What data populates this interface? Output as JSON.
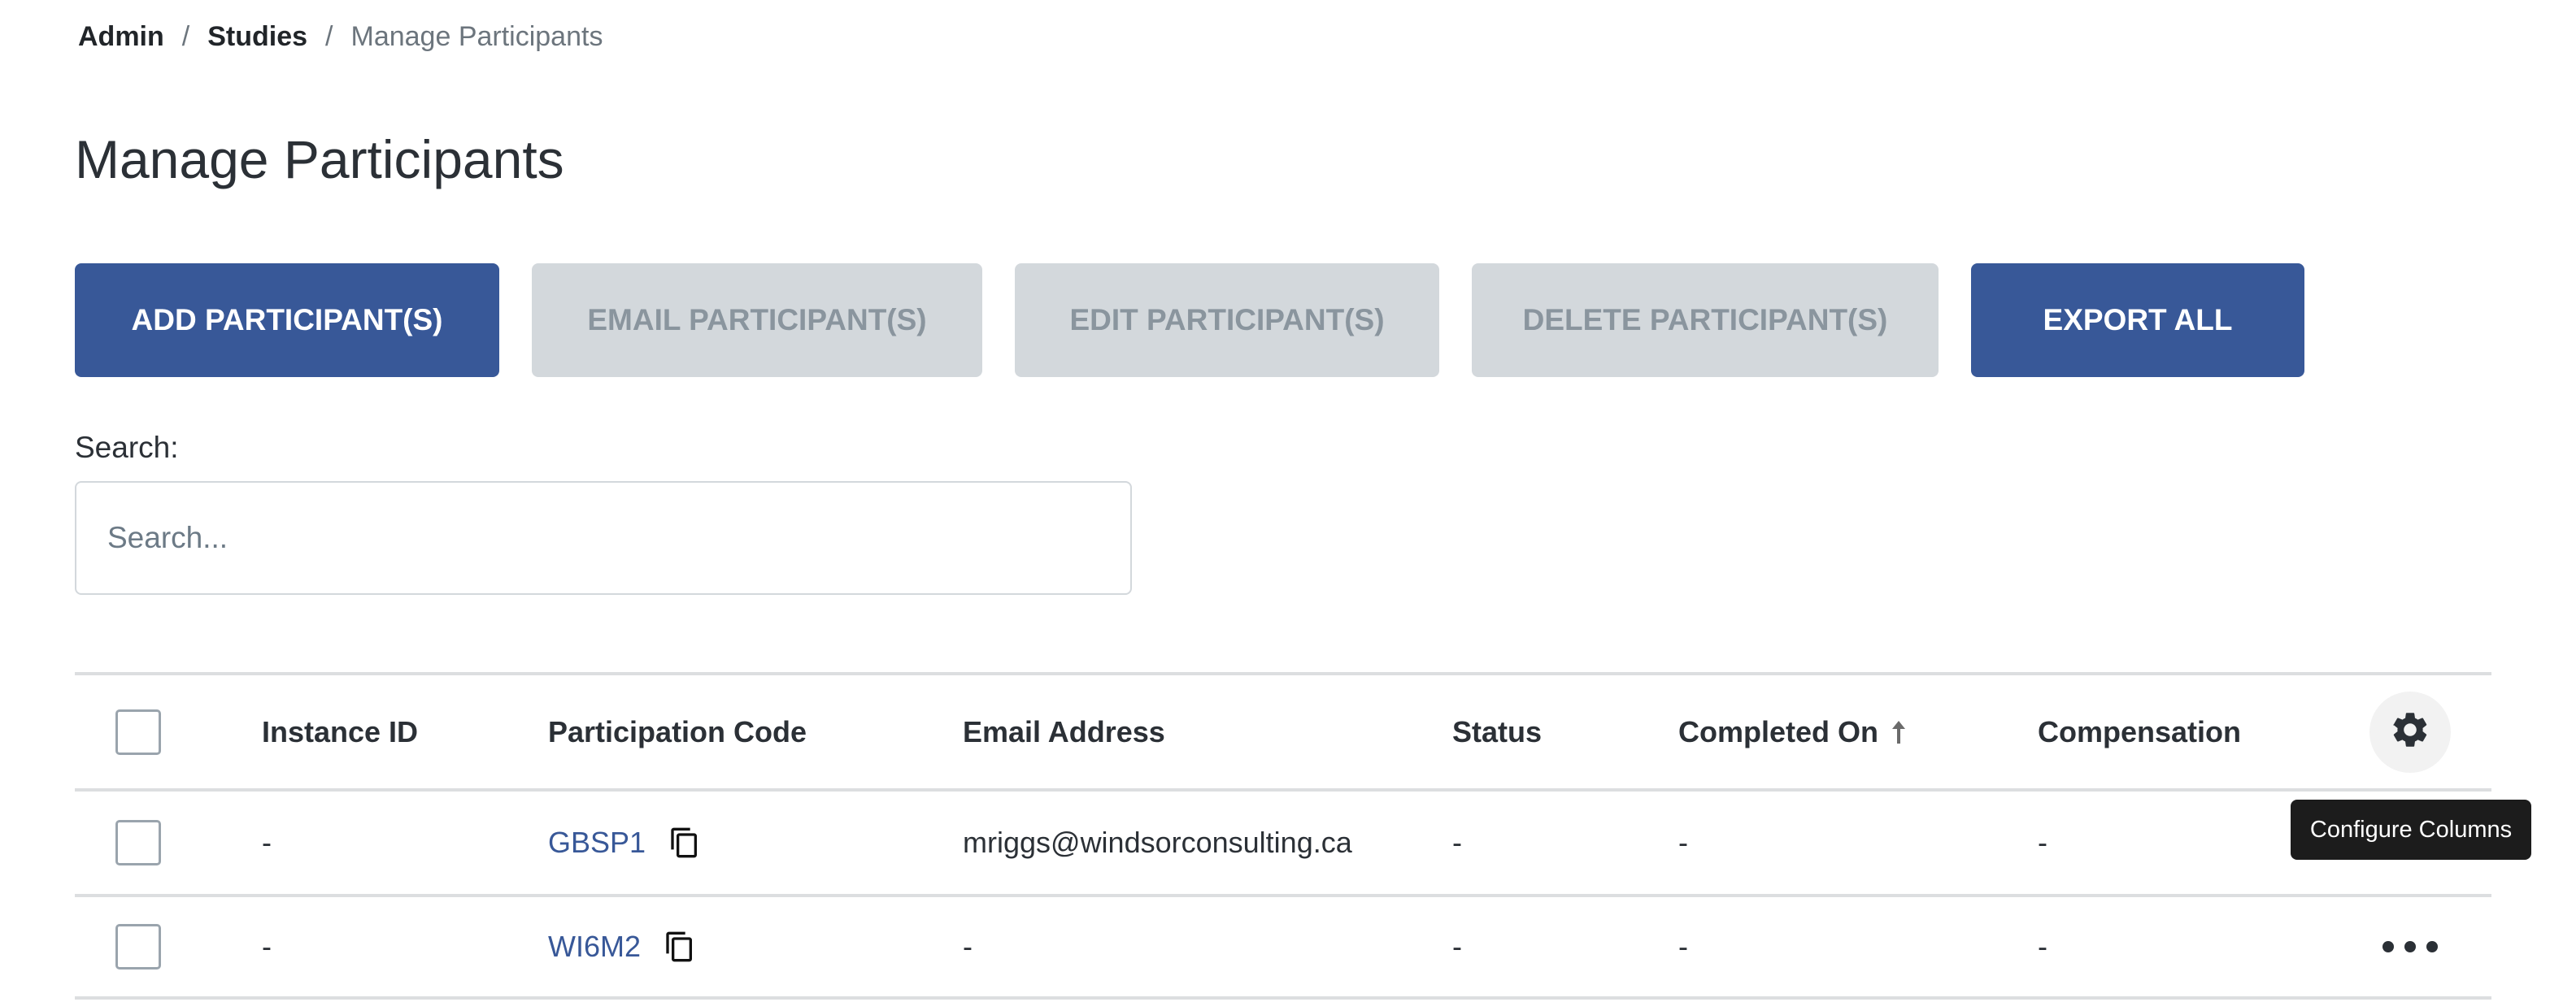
{
  "breadcrumb": {
    "items": [
      "Admin",
      "Studies"
    ],
    "separator": "/",
    "current": "Manage Participants"
  },
  "page": {
    "title": "Manage Participants"
  },
  "toolbar": {
    "add_label": "ADD PARTICIPANT(S)",
    "email_label": "EMAIL PARTICIPANT(S)",
    "edit_label": "EDIT PARTICIPANT(S)",
    "delete_label": "DELETE PARTICIPANT(S)",
    "export_label": "EXPORT ALL"
  },
  "search": {
    "label": "Search:",
    "placeholder": "Search...",
    "value": ""
  },
  "table": {
    "columns": [
      "Instance ID",
      "Participation Code",
      "Email Address",
      "Status",
      "Completed On",
      "Compensation"
    ],
    "sorted_column": "Completed On",
    "sort_direction": "ascending",
    "rows": [
      {
        "instance_id": "-",
        "code": "GBSP1",
        "email": "mriggs@windsorconsulting.ca",
        "status": "-",
        "completed_on": "-",
        "compensation": "-"
      },
      {
        "instance_id": "-",
        "code": "WI6M2",
        "email": "-",
        "status": "-",
        "completed_on": "-",
        "compensation": "-"
      }
    ]
  },
  "tooltip": {
    "text": "Configure Columns"
  },
  "icons": {
    "settings": "gear-icon",
    "copy": "copy-icon",
    "sort": "arrow-up-icon",
    "row_menu": "more-horizontal-icon"
  },
  "colors": {
    "primary": "#385898",
    "disabled_bg": "#d3d8dc",
    "disabled_text": "#8a959e",
    "tooltip_bg": "#1c1c1c"
  }
}
